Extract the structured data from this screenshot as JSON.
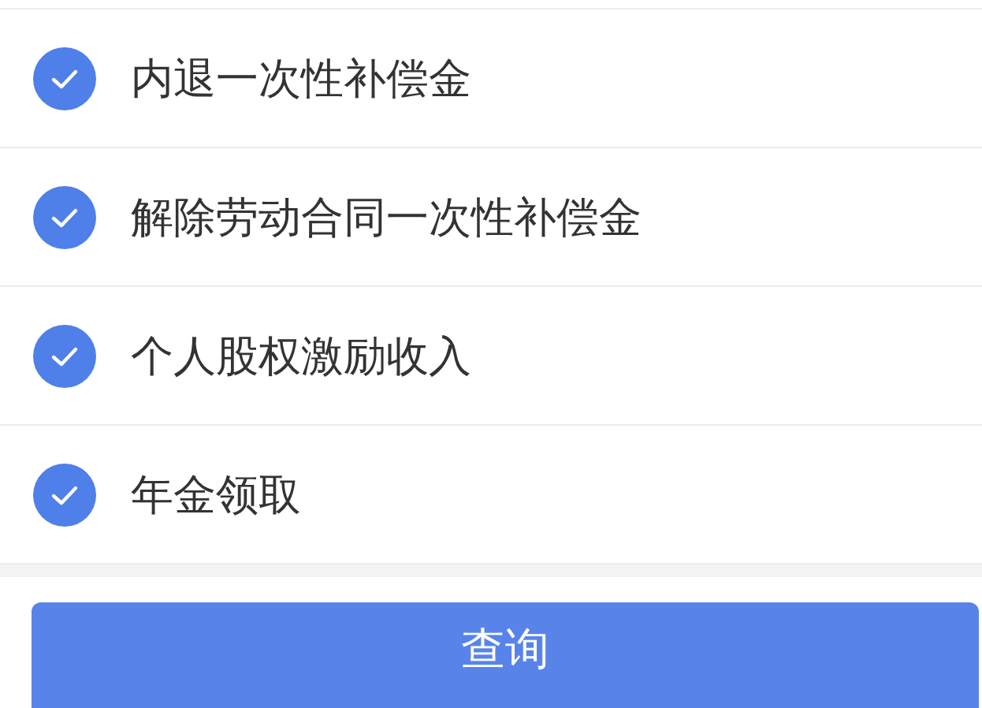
{
  "options": [
    {
      "label": "内退一次性补偿金",
      "checked": true
    },
    {
      "label": "解除劳动合同一次性补偿金",
      "checked": true
    },
    {
      "label": "个人股权激励收入",
      "checked": true
    },
    {
      "label": "年金领取",
      "checked": true
    }
  ],
  "button": {
    "label": "查询"
  }
}
